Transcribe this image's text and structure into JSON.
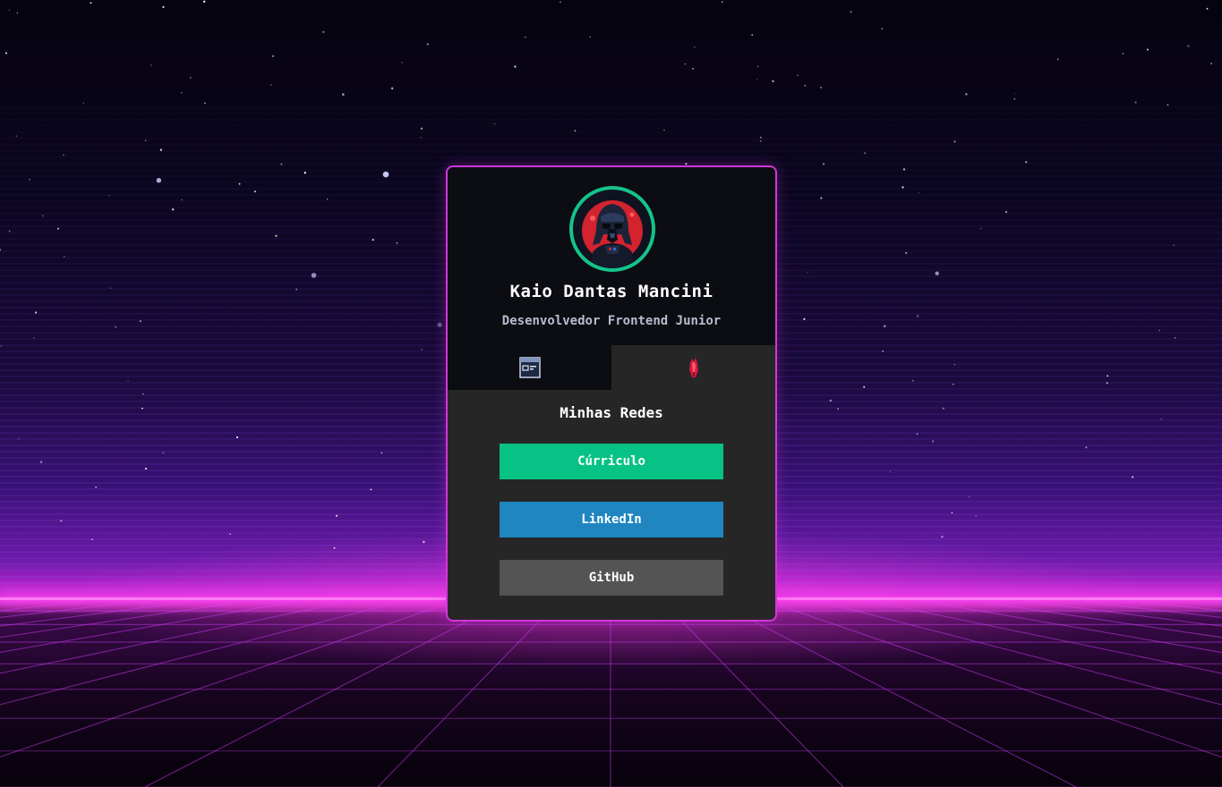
{
  "profile": {
    "name": "Kaio Dantas Mancini",
    "role": "Desenvolvedor Frontend Junior",
    "avatar_icon": "darth-vader-avatar-icon"
  },
  "tabs": [
    {
      "id": "projects",
      "icon": "browser-window-icon",
      "active": false
    },
    {
      "id": "social",
      "icon": "crystal-icon",
      "active": true
    }
  ],
  "social": {
    "title": "Minhas Redes",
    "links": [
      {
        "label": "Cúrriculo",
        "color": "#07c285"
      },
      {
        "label": "LinkedIn",
        "color": "#1f86c0"
      },
      {
        "label": "GitHub",
        "color": "#545454"
      }
    ]
  },
  "colors": {
    "card_border": "#d236d8",
    "avatar_ring": "#15c48a",
    "horizon_glow": "#ff3ee9"
  }
}
